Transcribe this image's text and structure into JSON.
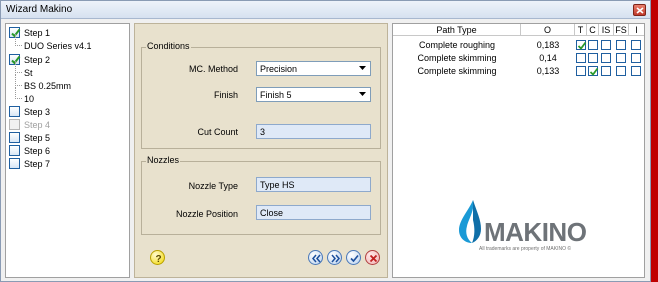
{
  "window": {
    "title": "Wizard Makino",
    "close_icon": "close-icon",
    "close_color": "#c0392b"
  },
  "tree": {
    "step1": {
      "label": "Step 1",
      "checked": true
    },
    "step1_child": "DUO Series v4.1",
    "step2": {
      "label": "Step 2",
      "checked": true
    },
    "step2_children": [
      "St",
      "BS 0.25mm",
      "10"
    ],
    "step3": {
      "label": "Step 3",
      "checked": false
    },
    "step4": {
      "label": "Step 4",
      "checked": false,
      "disabled": true
    },
    "step5": {
      "label": "Step 5",
      "checked": false
    },
    "step6": {
      "label": "Step 6",
      "checked": false
    },
    "step7": {
      "label": "Step 7",
      "checked": false
    }
  },
  "conditions": {
    "title": "Conditions",
    "mc_method_label": "MC. Method",
    "mc_method_value": "Precision",
    "finish_label": "Finish",
    "finish_value": "Finish 5",
    "cut_count_label": "Cut Count",
    "cut_count_value": "3"
  },
  "nozzles": {
    "title": "Nozzles",
    "nozzle_type_label": "Nozzle Type",
    "nozzle_type_value": "Type HS",
    "nozzle_position_label": "Nozzle Position",
    "nozzle_position_value": "Close"
  },
  "buttons": {
    "help_icon": "help-icon",
    "first_icon": "rewind-icon",
    "next_icon": "fast-forward-icon",
    "ok_icon": "checkmark-icon",
    "cancel_icon": "cancel-icon"
  },
  "path_table": {
    "headers": [
      "Path Type",
      "O",
      "T",
      "C",
      "IS",
      "FS",
      "I"
    ],
    "rows": [
      {
        "path_type": "Complete roughing",
        "o": "0,183",
        "flags": [
          true,
          false,
          false,
          false,
          false
        ]
      },
      {
        "path_type": "Complete skimming",
        "o": "0,14",
        "flags": [
          false,
          false,
          false,
          false,
          false
        ]
      },
      {
        "path_type": "Complete skimming",
        "o": "0,133",
        "flags": [
          false,
          true,
          false,
          false,
          false
        ]
      }
    ]
  },
  "logo": {
    "word": "MAKINO",
    "footnote": "All trademarks are property of MAKINO ©",
    "drop_color": "#1a9ad6",
    "text_color": "#6e7378"
  },
  "colors": {
    "panel_bg": "#e8e1cd",
    "accent_red": "#c00000",
    "check_blue": "#1f5fa0"
  }
}
